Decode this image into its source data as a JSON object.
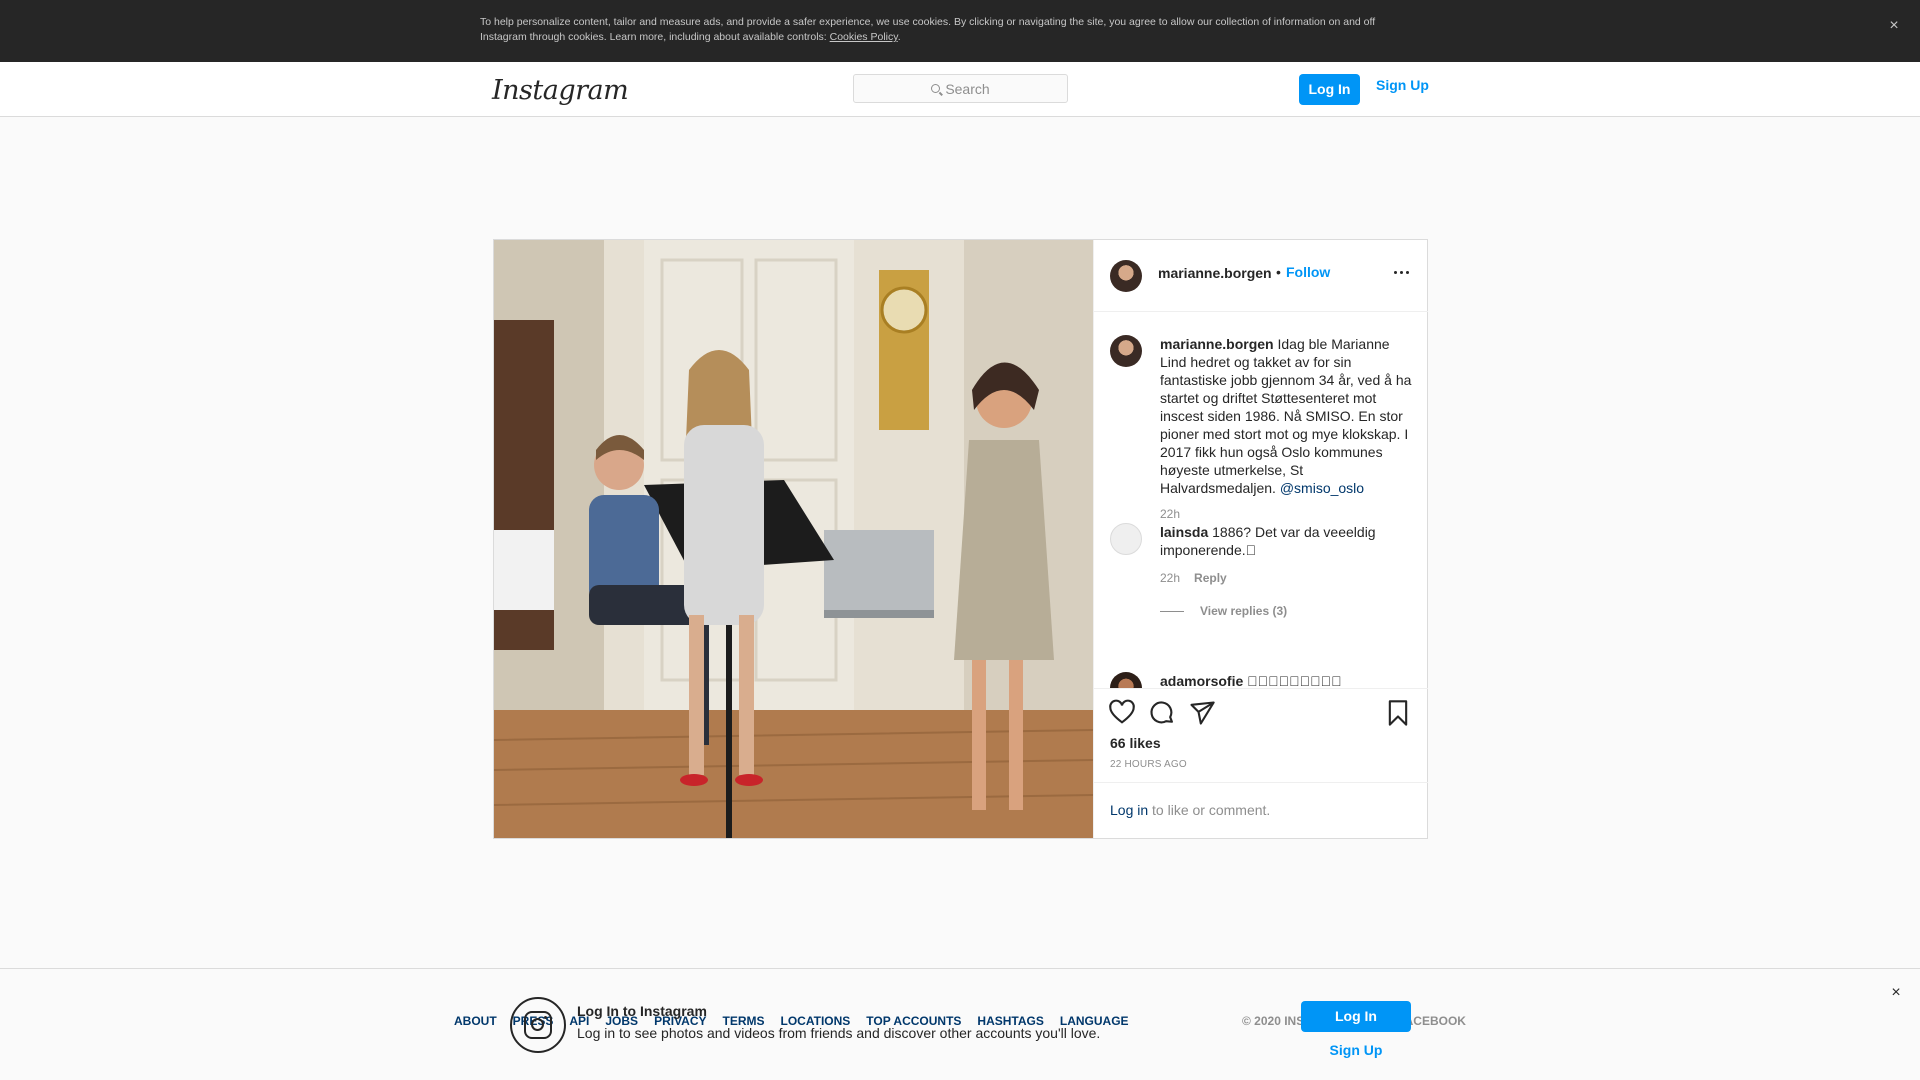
{
  "cookie_banner": {
    "text": "To help personalize content, tailor and measure ads, and provide a safer experience, we use cookies. By clicking or navigating the site, you agree to allow our collection of information on and off Instagram through cookies. Learn more, including about available controls:",
    "link_label": "Cookies Policy",
    "link_suffix": ".",
    "close_icon": "×"
  },
  "header": {
    "logo": "Instagram",
    "search_placeholder": "Search",
    "login_label": "Log In",
    "signup_label": "Sign Up"
  },
  "post": {
    "username": "marianne.borgen",
    "dot": "•",
    "follow_label": "Follow",
    "caption": {
      "username": "marianne.borgen",
      "text": " Idag ble Marianne Lind hedret og takket av for sin fantastiske jobb gjennom 34 år, ved å ha startet og driftet Støttesenteret mot inscest siden 1986. Nå SMISO. En stor pioner med stort mot og mye klokskap. I 2017 fikk hun også Oslo kommunes høyeste utmerkelse, St Halvardsmedaljen. ",
      "mention": "@smiso_oslo",
      "time": "22h"
    },
    "comments": [
      {
        "username": "lainsda",
        "text": " 1886? Det var da veeeldig imponerende.\u0000",
        "time": "22h",
        "reply_label": "Reply",
        "view_replies": "View replies (3)"
      },
      {
        "username": "adamorsofie",
        "text": " \u0000\u0000\u0000\u0000\u0000\u0000\u0000\u0000\u0000"
      }
    ],
    "likes": "66 likes",
    "timestamp": "22 HOURS AGO",
    "login_link": "Log in",
    "login_text": " to like or comment."
  },
  "footer": {
    "links": [
      "About",
      "Press",
      "API",
      "Jobs",
      "Privacy",
      "Terms",
      "Locations",
      "Top Accounts",
      "Hashtags",
      "Language"
    ],
    "copyright": "© 2020 Instagram from Facebook"
  },
  "bottom_banner": {
    "title": "Log In to Instagram",
    "subtitle": "Log in to see photos and videos from friends and discover other accounts you'll love.",
    "login_label": "Log In",
    "signup_label": "Sign Up",
    "close_icon": "×"
  },
  "colors": {
    "accent": "#0095f6",
    "link": "#00376b",
    "text": "#262626",
    "muted": "#8e8e8e"
  }
}
